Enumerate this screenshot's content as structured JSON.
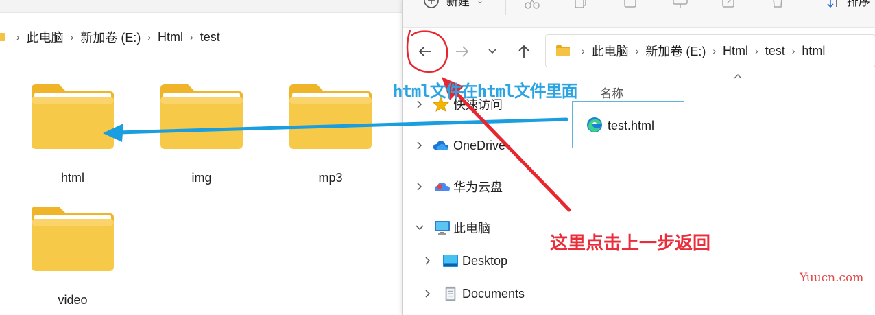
{
  "left": {
    "breadcrumb": [
      "此电脑",
      "新加卷 (E:)",
      "Html",
      "test"
    ],
    "folders": [
      "html",
      "img",
      "mp3",
      "video"
    ]
  },
  "right": {
    "toolbar": {
      "new_label": "新建",
      "sort_label": "排序"
    },
    "breadcrumb": [
      "此电脑",
      "新加卷 (E:)",
      "Html",
      "test",
      "html"
    ],
    "column_header": "名称",
    "sidebar": [
      {
        "label": "快速访问",
        "icon": "star-icon"
      },
      {
        "label": "OneDrive",
        "icon": "cloud-icon"
      },
      {
        "label": "华为云盘",
        "icon": "cloud-icon"
      },
      {
        "label": "此电脑",
        "icon": "monitor-icon"
      },
      {
        "label": "Desktop",
        "icon": "desktop-icon"
      },
      {
        "label": "Documents",
        "icon": "document-icon"
      }
    ],
    "file": {
      "name": "test.html",
      "icon": "edge-icon"
    }
  },
  "annotations": {
    "blue_text": "html文件在html文件里面",
    "red_text": "这里点击上一步返回"
  },
  "watermark": "Yuucn.com",
  "colors": {
    "blue_arrow": "#1a9ee0",
    "red_arrow": "#e8262f",
    "folder": "#f5c343",
    "selection": "#5fb6d9"
  }
}
